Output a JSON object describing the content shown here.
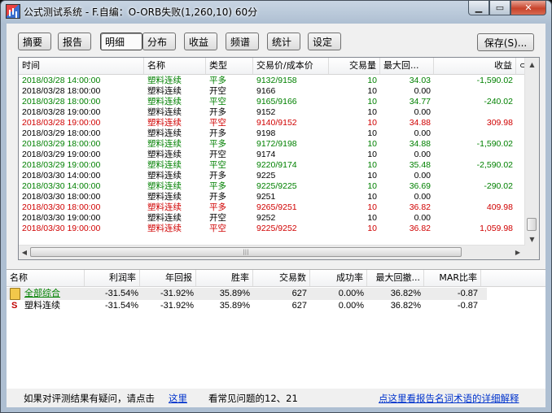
{
  "window": {
    "title": "公式测试系统 - F.自编：O-ORB失败(1,260,10) 60分",
    "min_label": "▁",
    "max_label": "▭",
    "close_label": "✕"
  },
  "tabs": [
    "摘要",
    "报告",
    "明细",
    "分布",
    "收益",
    "频谱",
    "统计",
    "设定"
  ],
  "active_tab": "明细",
  "save_label": "保存(S)...",
  "detail": {
    "columns": [
      "时间",
      "名称",
      "类型",
      "交易价/成本价",
      "交易量",
      "最大回...",
      "收益",
      "⊂"
    ],
    "rows": [
      {
        "time": "2018/03/28 14:00:00",
        "name": "塑料连续",
        "type": "平多",
        "price": "9132/9158",
        "qty": "10",
        "maxdd": "34.03",
        "profit": "-1,590.02",
        "color": "green"
      },
      {
        "time": "2018/03/28 18:00:00",
        "name": "塑料连续",
        "type": "开空",
        "price": "9166",
        "qty": "10",
        "maxdd": "0.00",
        "profit": "",
        "color": "black"
      },
      {
        "time": "2018/03/28 18:00:00",
        "name": "塑料连续",
        "type": "平空",
        "price": "9165/9166",
        "qty": "10",
        "maxdd": "34.77",
        "profit": "-240.02",
        "color": "green"
      },
      {
        "time": "2018/03/28 19:00:00",
        "name": "塑料连续",
        "type": "开多",
        "price": "9152",
        "qty": "10",
        "maxdd": "0.00",
        "profit": "",
        "color": "black"
      },
      {
        "time": "2018/03/28 19:00:00",
        "name": "塑料连续",
        "type": "平空",
        "price": "9140/9152",
        "qty": "10",
        "maxdd": "34.88",
        "profit": "309.98",
        "color": "red"
      },
      {
        "time": "2018/03/29 18:00:00",
        "name": "塑料连续",
        "type": "开多",
        "price": "9198",
        "qty": "10",
        "maxdd": "0.00",
        "profit": "",
        "color": "black"
      },
      {
        "time": "2018/03/29 18:00:00",
        "name": "塑料连续",
        "type": "平多",
        "price": "9172/9198",
        "qty": "10",
        "maxdd": "34.88",
        "profit": "-1,590.02",
        "color": "green"
      },
      {
        "time": "2018/03/29 19:00:00",
        "name": "塑料连续",
        "type": "开空",
        "price": "9174",
        "qty": "10",
        "maxdd": "0.00",
        "profit": "",
        "color": "black"
      },
      {
        "time": "2018/03/29 19:00:00",
        "name": "塑料连续",
        "type": "平空",
        "price": "9220/9174",
        "qty": "10",
        "maxdd": "35.48",
        "profit": "-2,590.02",
        "color": "green"
      },
      {
        "time": "2018/03/30 14:00:00",
        "name": "塑料连续",
        "type": "开多",
        "price": "9225",
        "qty": "10",
        "maxdd": "0.00",
        "profit": "",
        "color": "black"
      },
      {
        "time": "2018/03/30 14:00:00",
        "name": "塑料连续",
        "type": "平多",
        "price": "9225/9225",
        "qty": "10",
        "maxdd": "36.69",
        "profit": "-290.02",
        "color": "green"
      },
      {
        "time": "2018/03/30 18:00:00",
        "name": "塑料连续",
        "type": "开多",
        "price": "9251",
        "qty": "10",
        "maxdd": "0.00",
        "profit": "",
        "color": "black"
      },
      {
        "time": "2018/03/30 18:00:00",
        "name": "塑料连续",
        "type": "平多",
        "price": "9265/9251",
        "qty": "10",
        "maxdd": "36.82",
        "profit": "409.98",
        "color": "red"
      },
      {
        "time": "2018/03/30 19:00:00",
        "name": "塑料连续",
        "type": "开空",
        "price": "9252",
        "qty": "10",
        "maxdd": "0.00",
        "profit": "",
        "color": "black"
      },
      {
        "time": "2018/03/30 19:00:00",
        "name": "塑料连续",
        "type": "平空",
        "price": "9225/9252",
        "qty": "10",
        "maxdd": "36.82",
        "profit": "1,059.98",
        "color": "red"
      }
    ]
  },
  "summary": {
    "columns": [
      "名称",
      "利润率",
      "年回报",
      "胜率",
      "交易数",
      "成功率",
      "最大回撤...",
      "MAR比率"
    ],
    "rows": [
      {
        "name": "全部综合",
        "icon": "folder-icon",
        "profit_rate": "-31.54%",
        "annual": "-31.92%",
        "win": "35.89%",
        "trades": "627",
        "success": "0.00%",
        "maxdd": "36.82%",
        "mar": "-0.87",
        "link": true
      },
      {
        "name": "塑料连续",
        "icon": "s-icon",
        "icon_glyph": "S",
        "profit_rate": "-31.54%",
        "annual": "-31.92%",
        "win": "35.89%",
        "trades": "627",
        "success": "0.00%",
        "maxdd": "36.82%",
        "mar": "-0.87",
        "link": false
      }
    ]
  },
  "footer": {
    "question": "如果对评测结果有疑问，请点击",
    "here": "这里",
    "faq": "看常见问题的12、21",
    "glossary": "点这里看报告名词术语的详细解释"
  },
  "colors": {
    "green": "#008000",
    "red": "#d00000",
    "black": "#000000",
    "link": "#0033cc"
  }
}
